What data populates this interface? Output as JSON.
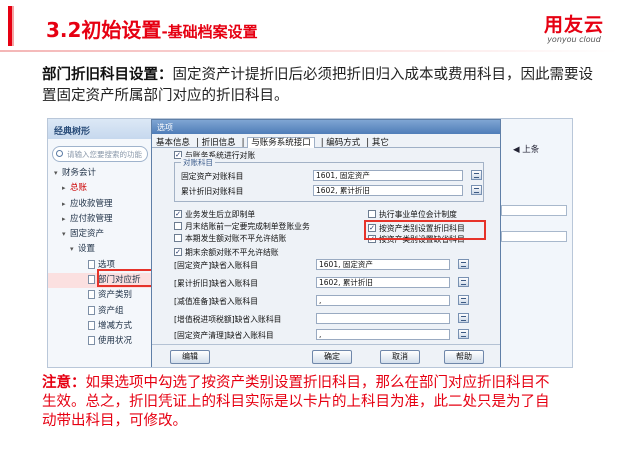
{
  "header": {
    "title": "3.2初始设置",
    "subtitle": "-基础档案设置",
    "logo_main": "用友云",
    "logo_sub": "yonyou cloud"
  },
  "intro": {
    "bold": "部门折旧科目设置：",
    "text": "固定资产计提折旧后必须把折旧归入成本或费用科目，因此需要设置固定资产所属部门对应的折旧科目。"
  },
  "left_pane": {
    "title": "经典树形",
    "search_placeholder": "请输入您要搜索的功能",
    "tree": [
      "财务会计",
      "总账",
      "应收款管理",
      "应付款管理",
      "固定资产",
      "设置",
      "选项",
      "部门对应折",
      "资产类别",
      "资产组",
      "增减方式",
      "使用状况"
    ]
  },
  "right_pane": {
    "nav": "上条"
  },
  "dialog": {
    "title": "选项",
    "tabs": [
      "基本信息",
      "折旧信息",
      "与账务系统接口",
      "编码方式",
      "其它"
    ],
    "active_tab": "与账务系统接口",
    "check_sync": "与账务系统进行对账",
    "group_label": "对账科目",
    "asset_account_label": "固定资产对账科目",
    "asset_account_value": "1601, 固定资产",
    "dep_account_label": "累计折旧对账科目",
    "dep_account_value": "1602, 累计折旧",
    "check_immediate": "业务发生后立即制单",
    "check_month_end": "月末结账前一定要完成制单登账业务",
    "check_imbalance": "本期发生额对账不平允许结账",
    "check_period_end": "期末余额对账不平允许结账",
    "check_public": "执行事业单位会计制度",
    "check_by_category": "按资产类别设置折旧科目",
    "check_by_category_default": "按资产类别设置缺省科目",
    "default_accounts": [
      {
        "label": "[固定资产]缺省入账科目",
        "value": "1601, 固定资产"
      },
      {
        "label": "[累计折旧]缺省入账科目",
        "value": "1602, 累计折旧"
      },
      {
        "label": "[减值准备]缺省入账科目",
        "value": ","
      },
      {
        "label": "[增值税进项税额]缺省入账科目",
        "value": ""
      },
      {
        "label": "[固定资产清理]缺省入账科目",
        "value": ","
      }
    ],
    "buttons": {
      "edit": "编辑",
      "ok": "确定",
      "cancel": "取消",
      "help": "帮助"
    }
  },
  "note": {
    "bold": "注意：",
    "text": "如果选项中勾选了按资产类别设置折旧科目，那么在部门对应折旧科目不生效。总之，折旧凭证上的科目实际是以卡片的上科目为准，此二处只是为了自动带出科目，可修改。"
  }
}
